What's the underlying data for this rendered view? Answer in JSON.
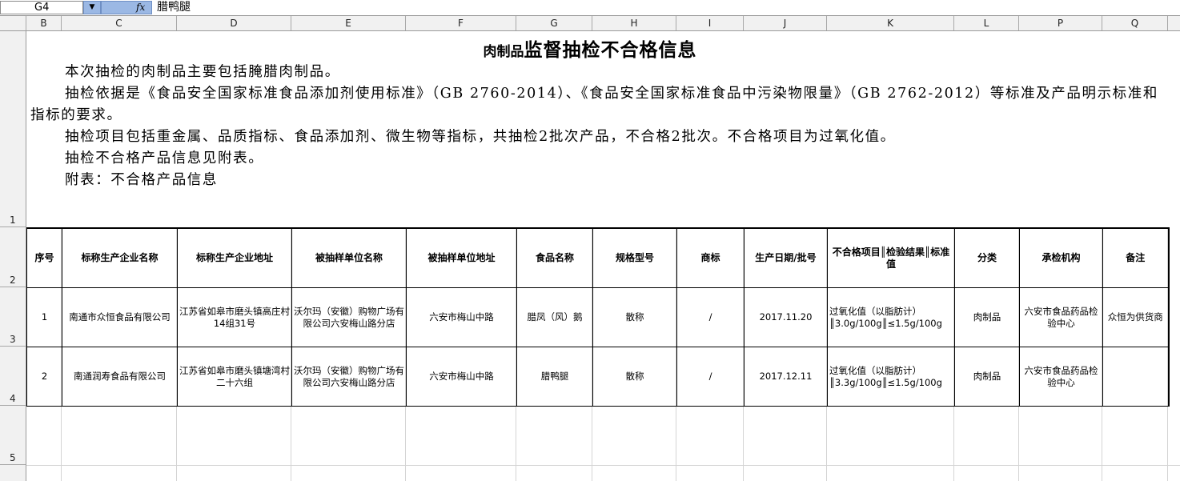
{
  "formula_bar": {
    "name_box": "G4",
    "fx_label": "fx",
    "content": "腊鸭腿"
  },
  "columns": [
    "B",
    "C",
    "D",
    "E",
    "F",
    "G",
    "H",
    "I",
    "J",
    "K",
    "L",
    "P",
    "Q"
  ],
  "rows": [
    "1",
    "2",
    "3",
    "4",
    "5"
  ],
  "title": {
    "small": "肉制品",
    "big": "监督抽检不合格信息"
  },
  "paragraphs": [
    "本次抽检的肉制品主要包括腌腊肉制品。",
    "抽检依据是《食品安全国家标准食品添加剂使用标准》（GB 2760-2014）、《食品安全国家标准食品中污染物限量》（GB 2762-2012）等标准及产品明示标准和指标的要求。",
    "抽检项目包括重金属、品质指标、食品添加剂、微生物等指标，共抽检2批次产品，不合格2批次。不合格项目为过氧化值。",
    "抽检不合格产品信息见附表。",
    "附表：不合格产品信息"
  ],
  "table": {
    "headers": [
      "序号",
      "标称生产企业名称",
      "标称生产企业地址",
      "被抽样单位名称",
      "被抽样单位地址",
      "食品名称",
      "规格型号",
      "商标",
      "生产日期/批号",
      "不合格项目║检验结果║标准值",
      "分类",
      "承检机构",
      "备注"
    ],
    "rows": [
      [
        "1",
        "南通市众恒食品有限公司",
        "江苏省如皋市磨头镇高庄村14组31号",
        "沃尔玛（安徽）购物广场有限公司六安梅山路分店",
        "六安市梅山中路",
        "腊凤（风）鹅",
        "散称",
        "/",
        "2017.11.20",
        "过氧化值（以脂肪计）║3.0g/100g║≤1.5g/100g",
        "肉制品",
        "六安市食品药品检验中心",
        "众恒为供货商"
      ],
      [
        "2",
        "南通润寿食品有限公司",
        "江苏省如皋市磨头镇塘湾村二十六组",
        "沃尔玛（安徽）购物广场有限公司六安梅山路分店",
        "六安市梅山中路",
        "腊鸭腿",
        "散称",
        "/",
        "2017.12.11",
        "过氧化值（以脂肪计）║3.3g/100g║≤1.5g/100g",
        "肉制品",
        "六安市食品药品检验中心",
        ""
      ]
    ]
  }
}
